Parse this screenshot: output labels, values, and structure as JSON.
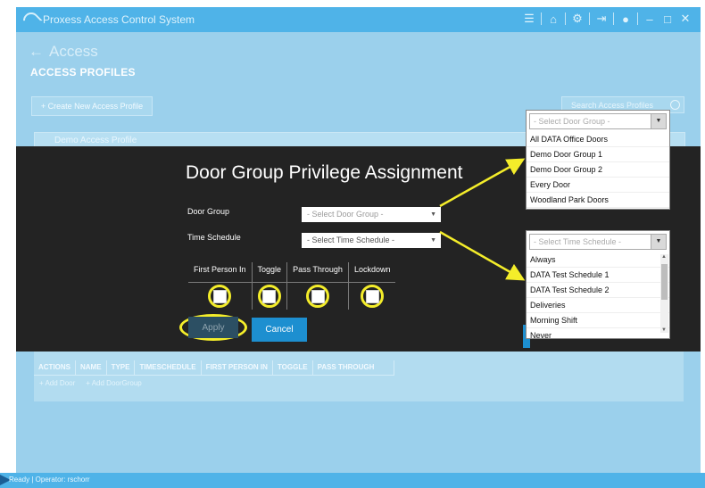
{
  "window": {
    "title": "Proxess Access Control System",
    "icons": [
      "menu-icon",
      "home-icon",
      "gear-icon",
      "logout-icon",
      "pin-icon",
      "minimize-icon",
      "maximize-icon",
      "close-icon"
    ]
  },
  "nav": {
    "back_arrow": "←",
    "back_label": "Access"
  },
  "page": {
    "title": "ACCESS PROFILES",
    "create_button": "+ Create New Access Profile",
    "search_placeholder": "Search Access Profiles",
    "profile_name": "Demo Access Profile"
  },
  "modal": {
    "title": "Door Group Privilege Assignment",
    "door_group_label": "Door Group",
    "door_group_placeholder": "- Select Door Group -",
    "time_schedule_label": "Time Schedule",
    "time_schedule_value": "- Select Time Schedule -",
    "privileges": [
      "First Person In",
      "Toggle",
      "Pass Through",
      "Lockdown"
    ],
    "apply": "Apply",
    "cancel": "Cancel"
  },
  "doors_table": {
    "columns": [
      "ACTIONS",
      "NAME",
      "TYPE",
      "TIMESCHEDULE",
      "FIRST PERSON IN",
      "TOGGLE",
      "PASS THROUGH"
    ],
    "add_door": "+ Add Door",
    "add_door_group": "+ Add DoorGroup"
  },
  "door_group_dropdown": {
    "placeholder": "- Select Door Group -",
    "options": [
      "All DATA Office Doors",
      "Demo Door Group 1",
      "Demo Door Group 2",
      "Every Door",
      "Woodland Park Doors"
    ]
  },
  "time_schedule_dropdown": {
    "placeholder": "- Select Time Schedule -",
    "options": [
      "Always",
      "DATA Test Schedule 1",
      "DATA Test Schedule 2",
      "Deliveries",
      "Morning Shift",
      "Never"
    ]
  },
  "status": {
    "text": "Ready | Operator: rschorr"
  },
  "colors": {
    "titlebar": "#4fb3e8",
    "modal_bg": "#232323",
    "accent": "#1d8fd0",
    "highlight": "#f4ed2a"
  }
}
